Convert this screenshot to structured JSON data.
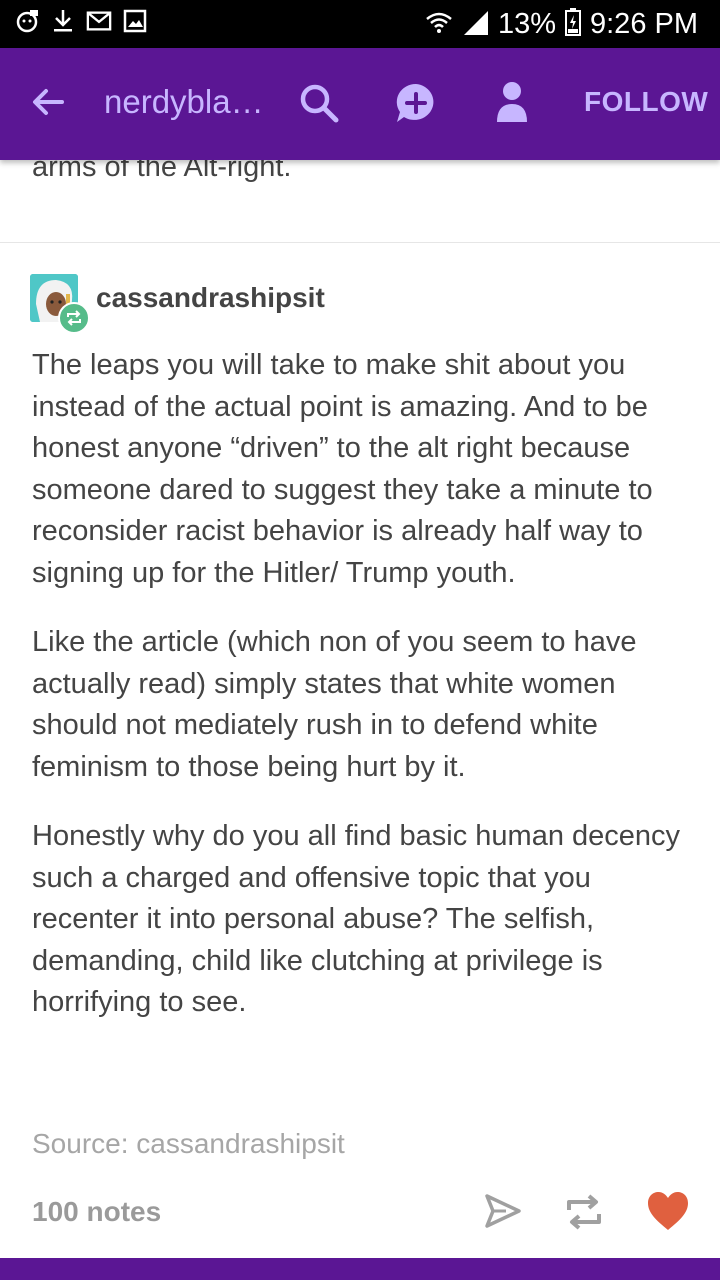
{
  "status_bar": {
    "battery": "13%",
    "time": "9:26 PM",
    "icons": [
      "notification-icon",
      "download-icon",
      "gmail-icon",
      "image-icon",
      "wifi-icon",
      "signal-icon",
      "battery-icon"
    ]
  },
  "app_bar": {
    "blog_name": "nerdybla…",
    "follow_label": "FOLLOW",
    "icons": [
      "back-arrow-icon",
      "search-icon",
      "message-icon",
      "person-icon"
    ],
    "colors": {
      "background": "#5b1694",
      "accent": "#c7b6ff"
    }
  },
  "previous_post": {
    "visible_text": "arms of the Alt-right."
  },
  "post": {
    "username": "cassandraship­sit",
    "paragraphs": [
      "The leaps you will take to make shit about you instead of the actual point is amazing. And to be honest anyone “driven” to the alt right because someone dared to suggest they take a minute to reconsider racist behavior is already half way to signing up for the Hitler/ Trump youth.",
      "Like the article (which non of you seem to have actually read) simply states that white women should not mediately rush in to defend white feminism to those being hurt by it.",
      "Honestly why do you all find basic human decency such a charged and offensive topic that you recenter it into personal abuse? The selfish, demanding, child like clutching at privilege is horrifying to see."
    ],
    "source": "Source: cassandrashipsit",
    "notes": "100 notes",
    "action_icons": [
      "share-icon",
      "reblog-icon",
      "heart-icon"
    ],
    "colors": {
      "heart": "#e0603f",
      "reblog_badge": "#56bc8a"
    }
  }
}
